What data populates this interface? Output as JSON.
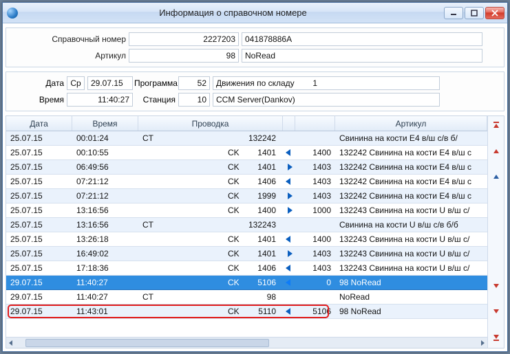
{
  "title": "Информация о справочном номере",
  "header_fields": {
    "ref_label": "Справочный номер",
    "ref_num": "2227203",
    "ref_value": "041878886A",
    "art_label": "Артикул",
    "art_num": "98",
    "art_value": "NoRead"
  },
  "info_fields": {
    "date_label": "Дата",
    "dow": "Ср",
    "date": "29.07.15",
    "time_label": "Время",
    "time": "11:40:27",
    "program_label": "Программа",
    "program_num": "52",
    "program_desc": "Движения по складу",
    "program_desc2": "1",
    "station_label": "Станция",
    "station_num": "10",
    "station_desc": "CCM Server(Dankov)"
  },
  "grid": {
    "headers": {
      "date": "Дата",
      "time": "Время",
      "prov": "Проводка",
      "art": "Артикул"
    },
    "rows": [
      {
        "date": "25.07.15",
        "time": "00:01:24",
        "ptype": "CT",
        "pnum": "",
        "pnum2": "132242",
        "arrow": "",
        "dest": "",
        "art": "Свинина на кости E4 в/ш с/в б/",
        "alt": true
      },
      {
        "date": "25.07.15",
        "time": "00:10:55",
        "ptype": "CK",
        "pnum": "1401",
        "pnum2": "",
        "arrow": "left",
        "dest": "1400",
        "art": "132242 Свинина на кости E4 в/ш с",
        "alt": false
      },
      {
        "date": "25.07.15",
        "time": "06:49:56",
        "ptype": "CK",
        "pnum": "1401",
        "pnum2": "",
        "arrow": "right",
        "dest": "1403",
        "art": "132242 Свинина на кости E4 в/ш с",
        "alt": true
      },
      {
        "date": "25.07.15",
        "time": "07:21:12",
        "ptype": "CK",
        "pnum": "1406",
        "pnum2": "",
        "arrow": "left",
        "dest": "1403",
        "art": "132242 Свинина на кости E4 в/ш с",
        "alt": false
      },
      {
        "date": "25.07.15",
        "time": "07:21:12",
        "ptype": "CK",
        "pnum": "1999",
        "pnum2": "",
        "arrow": "right",
        "dest": "1403",
        "art": "132242 Свинина на кости E4 в/ш с",
        "alt": true
      },
      {
        "date": "25.07.15",
        "time": "13:16:56",
        "ptype": "CK",
        "pnum": "1400",
        "pnum2": "",
        "arrow": "right",
        "dest": "1000",
        "art": "132243 Свинина на кости U в/ш с/",
        "alt": false
      },
      {
        "date": "25.07.15",
        "time": "13:16:56",
        "ptype": "CT",
        "pnum": "",
        "pnum2": "132243",
        "arrow": "",
        "dest": "",
        "art": "Свинина на кости U в/ш с/в б/б",
        "alt": true
      },
      {
        "date": "25.07.15",
        "time": "13:26:18",
        "ptype": "CK",
        "pnum": "1401",
        "pnum2": "",
        "arrow": "left",
        "dest": "1400",
        "art": "132243 Свинина на кости U в/ш с/",
        "alt": false
      },
      {
        "date": "25.07.15",
        "time": "16:49:02",
        "ptype": "CK",
        "pnum": "1401",
        "pnum2": "",
        "arrow": "right",
        "dest": "1403",
        "art": "132243 Свинина на кости U в/ш с/",
        "alt": true
      },
      {
        "date": "25.07.15",
        "time": "17:18:36",
        "ptype": "CK",
        "pnum": "1406",
        "pnum2": "",
        "arrow": "left",
        "dest": "1403",
        "art": "132243 Свинина на кости U в/ш с/",
        "alt": false
      },
      {
        "date": "29.07.15",
        "time": "11:40:27",
        "ptype": "CK",
        "pnum": "5106",
        "pnum2": "",
        "arrow": "left",
        "dest": "0",
        "art": "98 NoRead",
        "alt": false,
        "selected": true
      },
      {
        "date": "29.07.15",
        "time": "11:40:27",
        "ptype": "CT",
        "pnum": "",
        "pnum2": "98",
        "arrow": "",
        "dest": "",
        "art": "NoRead",
        "alt": false
      },
      {
        "date": "29.07.15",
        "time": "11:43:01",
        "ptype": "CK",
        "pnum": "5110",
        "pnum2": "",
        "arrow": "left",
        "dest": "5106",
        "art": "98 NoRead",
        "alt": true,
        "highlight": true
      }
    ]
  }
}
